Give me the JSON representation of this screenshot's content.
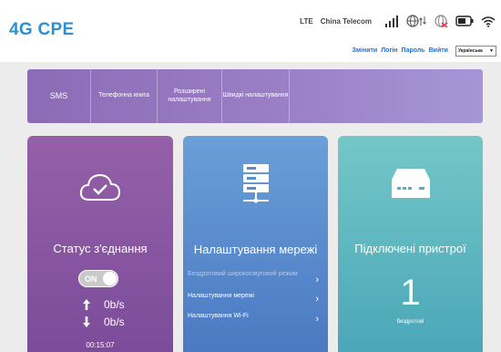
{
  "header": {
    "logo": "4G CPE",
    "network_mode": "LTE",
    "operator": "China Telecom",
    "links": [
      "Змінити",
      "Логін",
      "Пароль",
      "Вийти"
    ],
    "language": "Українська"
  },
  "menu": {
    "items": [
      {
        "label": "SMS"
      },
      {
        "label": "Телефонна книга"
      },
      {
        "label": "Розширені налаштування"
      },
      {
        "label": "Швидкі налаштування"
      }
    ]
  },
  "cards": {
    "status": {
      "title": "Статус з'єднання",
      "toggle_label": "ON",
      "upload": "0b/s",
      "download": "0b/s",
      "duration": "00:15:07"
    },
    "network": {
      "title": "Налаштування мережі",
      "links": [
        "Бездротовий широкосмуговий режим",
        "Налаштування мережі",
        "Налаштування Wi-Fi"
      ]
    },
    "devices": {
      "title": "Підключені пристрої",
      "count": "1",
      "label": "бездротові"
    }
  }
}
